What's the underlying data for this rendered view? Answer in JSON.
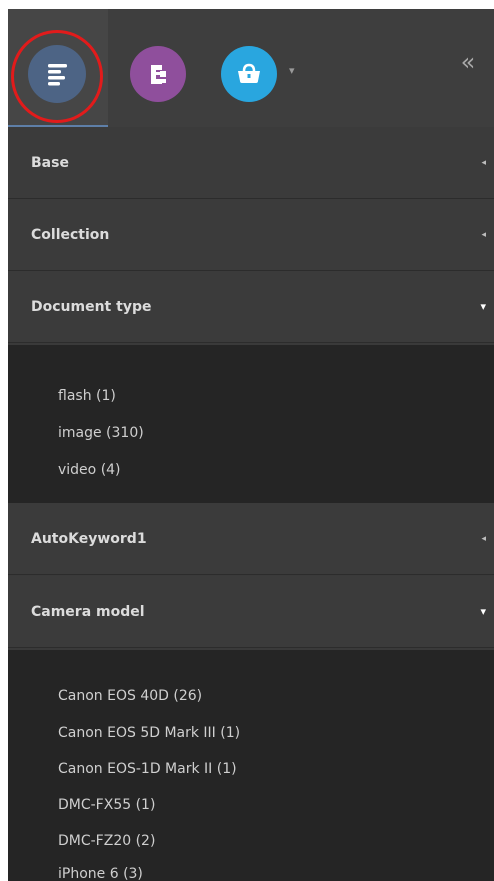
{
  "toolbar": {
    "collapse_glyph": "«",
    "buttons": [
      {
        "name": "facets",
        "icon": "list-lines-icon"
      },
      {
        "name": "thesaurus",
        "icon": "tree-icon"
      },
      {
        "name": "basket",
        "icon": "basket-icon"
      }
    ],
    "dropdown_glyph": "▾"
  },
  "sections": [
    {
      "title": "Base",
      "caret": "◂",
      "open": false,
      "items": []
    },
    {
      "title": "Collection",
      "caret": "◂",
      "open": false,
      "items": []
    },
    {
      "title": "Document type",
      "caret": "▾",
      "open": true,
      "items": [
        "flash (1)",
        "image (310)",
        "video (4)"
      ]
    },
    {
      "title": "AutoKeyword1",
      "caret": "◂",
      "open": false,
      "items": []
    },
    {
      "title": "Camera model",
      "caret": "▾",
      "open": true,
      "items": [
        "Canon EOS 40D (26)",
        "Canon EOS 5D Mark III (1)",
        "Canon EOS-1D Mark II (1)",
        "DMC-FX55 (1)",
        "DMC-FZ20 (2)",
        "iPhone 6 (3)"
      ]
    }
  ],
  "colors": {
    "panel_bg": "#3b3b3b",
    "body_bg": "#252525",
    "facets_button": "#4d6485",
    "thesaurus_button": "#8f4f9c",
    "basket_button": "#29a6df",
    "highlight_ring": "#e21b1b",
    "active_underline": "#5e7fa8"
  }
}
